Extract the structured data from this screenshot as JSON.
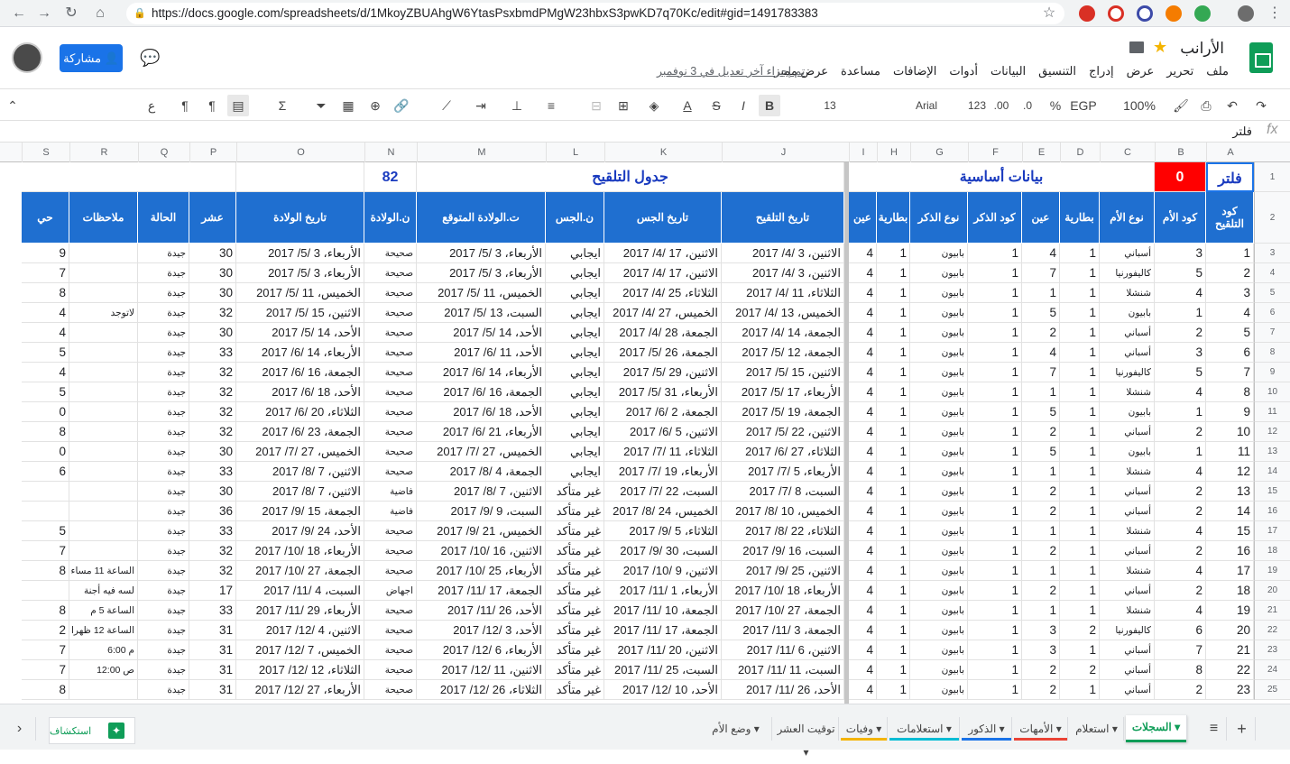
{
  "browser": {
    "url": "https://docs.google.com/spreadsheets/d/1MkoyZBUAhgW6YtasPsxbmdPMgW23hbxS3pwKD7q70Kc/edit#gid=1491783383"
  },
  "app": {
    "title": "الأرانب",
    "share_label": "مشاركة",
    "last_edit": "تم إجراء آخر تعديل في 3 نوفمبر",
    "menu": [
      "ملف",
      "تحرير",
      "عرض",
      "إدراج",
      "التنسيق",
      "البيانات",
      "أدوات",
      "الإضافات",
      "مساعدة",
      "عرض مميز"
    ]
  },
  "toolbar": {
    "zoom": "100%",
    "currency": "EGP",
    "percent": "%",
    "dec_less": ".0",
    "dec_more": ".00",
    "num_format": "123",
    "font": "Arial",
    "font_size": "13",
    "bold": "B",
    "italic": "I",
    "strike": "S",
    "textcolor": "A",
    "sigma": "Σ",
    "ltr": "¶",
    "rtl": "¶",
    "arabic": "ع"
  },
  "formula": {
    "fx": "fx",
    "content": "فلتر"
  },
  "columns": [
    "A",
    "B",
    "C",
    "D",
    "E",
    "F",
    "G",
    "H",
    "I",
    "J",
    "K",
    "L",
    "M",
    "N",
    "O",
    "P",
    "Q",
    "R",
    "S"
  ],
  "row1": {
    "filter": "فلتر",
    "count": "0",
    "basic": "بيانات أساسية",
    "pollination": "جدول التلقيح",
    "births": "82"
  },
  "headers": {
    "A": "كود التلقيح",
    "B": "كود الأم",
    "C": "نوع الأم",
    "D": "بطارية",
    "E": "عين",
    "F": "كود الذكر",
    "G": "نوع الذكر",
    "H": "بطارية",
    "I": "عين",
    "J": "تاريخ التلقيح",
    "K": "تاريخ الجس",
    "L": "ن.الجس",
    "M": "ت.الولادة المتوقع",
    "N": "ن.الولادة",
    "O": "تاريخ الولادة",
    "P": "عشر",
    "Q": "الحالة",
    "R": "ملاحظات",
    "S": "حي"
  },
  "rows": [
    {
      "r": "3",
      "A": "1",
      "B": "3",
      "C": "أسباني",
      "D": "1",
      "E": "4",
      "F": "1",
      "G": "بابيون",
      "H": "1",
      "I": "4",
      "J": "الاثنين، 3 /4/ 2017",
      "K": "الاثنين، 17 /4/ 2017",
      "L": "ايجابي",
      "M": "الأربعاء، 3 /5/ 2017",
      "N": "صحيحة",
      "O": "الأربعاء، 3 /5/ 2017",
      "P": "30",
      "Q": "جيدة",
      "R": "",
      "S": "9"
    },
    {
      "r": "4",
      "A": "2",
      "B": "5",
      "C": "كاليفورنيا",
      "D": "1",
      "E": "7",
      "F": "1",
      "G": "بابيون",
      "H": "1",
      "I": "4",
      "J": "الاثنين، 3 /4/ 2017",
      "K": "الاثنين، 17 /4/ 2017",
      "L": "ايجابي",
      "M": "الأربعاء، 3 /5/ 2017",
      "N": "صحيحة",
      "O": "الأربعاء، 3 /5/ 2017",
      "P": "30",
      "Q": "جيدة",
      "R": "",
      "S": "7"
    },
    {
      "r": "5",
      "A": "3",
      "B": "4",
      "C": "شنشلا",
      "D": "1",
      "E": "1",
      "F": "1",
      "G": "بابيون",
      "H": "1",
      "I": "4",
      "J": "الثلاثاء، 11 /4/ 2017",
      "K": "الثلاثاء، 25 /4/ 2017",
      "L": "ايجابي",
      "M": "الخميس، 11 /5/ 2017",
      "N": "صحيحة",
      "O": "الخميس، 11 /5/ 2017",
      "P": "30",
      "Q": "جيدة",
      "R": "",
      "S": "8"
    },
    {
      "r": "6",
      "A": "4",
      "B": "1",
      "C": "بابيون",
      "D": "1",
      "E": "5",
      "F": "1",
      "G": "بابيون",
      "H": "1",
      "I": "4",
      "J": "الخميس، 13 /4/ 2017",
      "K": "الخميس، 27 /4/ 2017",
      "L": "ايجابي",
      "M": "السبت، 13 /5/ 2017",
      "N": "صحيحة",
      "O": "الاثنين، 15 /5/ 2017",
      "P": "32",
      "Q": "جيدة",
      "R": "لاتوجد",
      "S": "4"
    },
    {
      "r": "7",
      "A": "5",
      "B": "2",
      "C": "أسباني",
      "D": "1",
      "E": "2",
      "F": "1",
      "G": "بابيون",
      "H": "1",
      "I": "4",
      "J": "الجمعة، 14 /4/ 2017",
      "K": "الجمعة، 28 /4/ 2017",
      "L": "ايجابي",
      "M": "الأحد، 14 /5/ 2017",
      "N": "صحيحة",
      "O": "الأحد، 14 /5/ 2017",
      "P": "30",
      "Q": "جيدة",
      "R": "",
      "S": "4"
    },
    {
      "r": "8",
      "A": "6",
      "B": "3",
      "C": "أسباني",
      "D": "1",
      "E": "4",
      "F": "1",
      "G": "بابيون",
      "H": "1",
      "I": "4",
      "J": "الجمعة، 12 /5/ 2017",
      "K": "الجمعة، 26 /5/ 2017",
      "L": "ايجابي",
      "M": "الأحد، 11 /6/ 2017",
      "N": "صحيحة",
      "O": "الأربعاء، 14 /6/ 2017",
      "P": "33",
      "Q": "جيدة",
      "R": "",
      "S": "5"
    },
    {
      "r": "9",
      "A": "7",
      "B": "5",
      "C": "كاليفورنيا",
      "D": "1",
      "E": "7",
      "F": "1",
      "G": "بابيون",
      "H": "1",
      "I": "4",
      "J": "الاثنين، 15 /5/ 2017",
      "K": "الاثنين، 29 /5/ 2017",
      "L": "ايجابي",
      "M": "الأربعاء، 14 /6/ 2017",
      "N": "صحيحة",
      "O": "الجمعة، 16 /6/ 2017",
      "P": "32",
      "Q": "جيدة",
      "R": "",
      "S": "4"
    },
    {
      "r": "10",
      "A": "8",
      "B": "4",
      "C": "شنشلا",
      "D": "1",
      "E": "1",
      "F": "1",
      "G": "بابيون",
      "H": "1",
      "I": "4",
      "J": "الأربعاء، 17 /5/ 2017",
      "K": "الأربعاء، 31 /5/ 2017",
      "L": "ايجابي",
      "M": "الجمعة، 16 /6/ 2017",
      "N": "صحيحة",
      "O": "الأحد، 18 /6/ 2017",
      "P": "32",
      "Q": "جيدة",
      "R": "",
      "S": "5"
    },
    {
      "r": "11",
      "A": "9",
      "B": "1",
      "C": "بابيون",
      "D": "1",
      "E": "5",
      "F": "1",
      "G": "بابيون",
      "H": "1",
      "I": "4",
      "J": "الجمعة، 19 /5/ 2017",
      "K": "الجمعة، 2 /6/ 2017",
      "L": "ايجابي",
      "M": "الأحد، 18 /6/ 2017",
      "N": "صحيحة",
      "O": "الثلاثاء، 20 /6/ 2017",
      "P": "32",
      "Q": "جيدة",
      "R": "",
      "S": "0"
    },
    {
      "r": "12",
      "A": "10",
      "B": "2",
      "C": "أسباني",
      "D": "1",
      "E": "2",
      "F": "1",
      "G": "بابيون",
      "H": "1",
      "I": "4",
      "J": "الاثنين، 22 /5/ 2017",
      "K": "الاثنين، 5 /6/ 2017",
      "L": "ايجابي",
      "M": "الأربعاء، 21 /6/ 2017",
      "N": "صحيحة",
      "O": "الجمعة، 23 /6/ 2017",
      "P": "32",
      "Q": "جيدة",
      "R": "",
      "S": "8"
    },
    {
      "r": "13",
      "A": "11",
      "B": "1",
      "C": "بابيون",
      "D": "1",
      "E": "5",
      "F": "1",
      "G": "بابيون",
      "H": "1",
      "I": "4",
      "J": "الثلاثاء، 27 /6/ 2017",
      "K": "الثلاثاء، 11 /7/ 2017",
      "L": "ايجابي",
      "M": "الخميس، 27 /7/ 2017",
      "N": "صحيحة",
      "O": "الخميس، 27 /7/ 2017",
      "P": "30",
      "Q": "جيدة",
      "R": "",
      "S": "0"
    },
    {
      "r": "14",
      "A": "12",
      "B": "4",
      "C": "شنشلا",
      "D": "1",
      "E": "1",
      "F": "1",
      "G": "بابيون",
      "H": "1",
      "I": "4",
      "J": "الأربعاء، 5 /7/ 2017",
      "K": "الأربعاء، 19 /7/ 2017",
      "L": "ايجابي",
      "M": "الجمعة، 4 /8/ 2017",
      "N": "صحيحة",
      "O": "الاثنين، 7 /8/ 2017",
      "P": "33",
      "Q": "جيدة",
      "R": "",
      "S": "6"
    },
    {
      "r": "15",
      "A": "13",
      "B": "2",
      "C": "أسباني",
      "D": "1",
      "E": "2",
      "F": "1",
      "G": "بابيون",
      "H": "1",
      "I": "4",
      "J": "السبت، 8 /7/ 2017",
      "K": "السبت، 22 /7/ 2017",
      "L": "غير متأكد",
      "M": "الاثنين، 7 /8/ 2017",
      "N": "فاضية",
      "O": "الاثنين، 7 /8/ 2017",
      "P": "30",
      "Q": "جيدة",
      "R": "",
      "S": ""
    },
    {
      "r": "16",
      "A": "14",
      "B": "2",
      "C": "أسباني",
      "D": "1",
      "E": "2",
      "F": "1",
      "G": "بابيون",
      "H": "1",
      "I": "4",
      "J": "الخميس، 10 /8/ 2017",
      "K": "الخميس، 24 /8/ 2017",
      "L": "غير متأكد",
      "M": "السبت، 9 /9/ 2017",
      "N": "فاضية",
      "O": "الجمعة، 15 /9/ 2017",
      "P": "36",
      "Q": "جيدة",
      "R": "",
      "S": ""
    },
    {
      "r": "17",
      "A": "15",
      "B": "4",
      "C": "شنشلا",
      "D": "1",
      "E": "1",
      "F": "1",
      "G": "بابيون",
      "H": "1",
      "I": "4",
      "J": "الثلاثاء، 22 /8/ 2017",
      "K": "الثلاثاء، 5 /9/ 2017",
      "L": "غير متأكد",
      "M": "الخميس، 21 /9/ 2017",
      "N": "صحيحة",
      "O": "الأحد، 24 /9/ 2017",
      "P": "33",
      "Q": "جيدة",
      "R": "",
      "S": "5"
    },
    {
      "r": "18",
      "A": "16",
      "B": "2",
      "C": "أسباني",
      "D": "1",
      "E": "2",
      "F": "1",
      "G": "بابيون",
      "H": "1",
      "I": "4",
      "J": "السبت، 16 /9/ 2017",
      "K": "السبت، 30 /9/ 2017",
      "L": "غير متأكد",
      "M": "الاثنين، 16 /10/ 2017",
      "N": "صحيحة",
      "O": "الأربعاء، 18 /10/ 2017",
      "P": "32",
      "Q": "جيدة",
      "R": "",
      "S": "7"
    },
    {
      "r": "19",
      "A": "17",
      "B": "4",
      "C": "شنشلا",
      "D": "1",
      "E": "1",
      "F": "1",
      "G": "بابيون",
      "H": "1",
      "I": "4",
      "J": "الاثنين، 25 /9/ 2017",
      "K": "الاثنين، 9 /10/ 2017",
      "L": "غير متأكد",
      "M": "الأربعاء، 25 /10/ 2017",
      "N": "صحيحة",
      "O": "الجمعة، 27 /10/ 2017",
      "P": "32",
      "Q": "جيدة",
      "R": "الساعة 11 مساء ا",
      "S": "8"
    },
    {
      "r": "20",
      "A": "18",
      "B": "2",
      "C": "أسباني",
      "D": "1",
      "E": "2",
      "F": "1",
      "G": "بابيون",
      "H": "1",
      "I": "4",
      "J": "الأربعاء، 18 /10/ 2017",
      "K": "الأربعاء، 1 /11/ 2017",
      "L": "غير متأكد",
      "M": "الجمعة، 17 /11/ 2017",
      "N": "اجهاض",
      "O": "السبت، 4 /11/ 2017",
      "P": "17",
      "Q": "جيدة",
      "R": "لسه فيه أجنة",
      "S": ""
    },
    {
      "r": "21",
      "A": "19",
      "B": "4",
      "C": "شنشلا",
      "D": "1",
      "E": "1",
      "F": "1",
      "G": "بابيون",
      "H": "1",
      "I": "4",
      "J": "الجمعة، 27 /10/ 2017",
      "K": "الجمعة، 10 /11/ 2017",
      "L": "غير متأكد",
      "M": "الأحد، 26 /11/ 2017",
      "N": "صحيحة",
      "O": "الأربعاء، 29 /11/ 2017",
      "P": "33",
      "Q": "جيدة",
      "R": "الساعة 5 م",
      "S": "8"
    },
    {
      "r": "22",
      "A": "20",
      "B": "6",
      "C": "كاليفورنيا",
      "D": "2",
      "E": "3",
      "F": "1",
      "G": "بابيون",
      "H": "1",
      "I": "4",
      "J": "الجمعة، 3 /11/ 2017",
      "K": "الجمعة، 17 /11/ 2017",
      "L": "غير متأكد",
      "M": "الأحد، 3 /12/ 2017",
      "N": "صحيحة",
      "O": "الاثنين، 4 /12/ 2017",
      "P": "31",
      "Q": "جيدة",
      "R": "الساعة 12 ظهرا",
      "S": "2"
    },
    {
      "r": "23",
      "A": "21",
      "B": "7",
      "C": "أسباني",
      "D": "1",
      "E": "3",
      "F": "1",
      "G": "بابيون",
      "H": "1",
      "I": "4",
      "J": "الاثنين، 6 /11/ 2017",
      "K": "الاثنين، 20 /11/ 2017",
      "L": "غير متأكد",
      "M": "الأربعاء، 6 /12/ 2017",
      "N": "صحيحة",
      "O": "الخميس، 7 /12/ 2017",
      "P": "31",
      "Q": "جيدة",
      "R": "م 6:00",
      "S": "7"
    },
    {
      "r": "24",
      "A": "22",
      "B": "8",
      "C": "أسباني",
      "D": "2",
      "E": "2",
      "F": "1",
      "G": "بابيون",
      "H": "1",
      "I": "4",
      "J": "السبت، 11 /11/ 2017",
      "K": "السبت، 25 /11/ 2017",
      "L": "غير متأكد",
      "M": "الاثنين، 11 /12/ 2017",
      "N": "صحيحة",
      "O": "الثلاثاء، 12 /12/ 2017",
      "P": "31",
      "Q": "جيدة",
      "R": "ص 12:00",
      "S": "7"
    },
    {
      "r": "25",
      "A": "23",
      "B": "2",
      "C": "أسباني",
      "D": "1",
      "E": "2",
      "F": "1",
      "G": "بابيون",
      "H": "1",
      "I": "4",
      "J": "الأحد، 26 /11/ 2017",
      "K": "الأحد، 10 /12/ 2017",
      "L": "غير متأكد",
      "M": "الثلاثاء، 26 /12/ 2017",
      "N": "صحيحة",
      "O": "الأربعاء، 27 /12/ 2017",
      "P": "31",
      "Q": "جيدة",
      "R": "",
      "S": "8"
    }
  ],
  "tabs": [
    {
      "label": "السجلات",
      "color": "#0f9d58",
      "active": true
    },
    {
      "label": "استعلام",
      "color": "",
      "active": false
    },
    {
      "label": "الأمهات",
      "color": "#ea4335",
      "active": false
    },
    {
      "label": "الذكور",
      "color": "#1a73e8",
      "active": false
    },
    {
      "label": "استعلامات",
      "color": "#00bcd4",
      "active": false
    },
    {
      "label": "وفيات",
      "color": "#f4b400",
      "active": false
    },
    {
      "label": "توقيت العشر",
      "color": "",
      "active": false
    },
    {
      "label": "وضع الأم",
      "color": "",
      "active": false
    }
  ],
  "explore_label": "استكشاف"
}
